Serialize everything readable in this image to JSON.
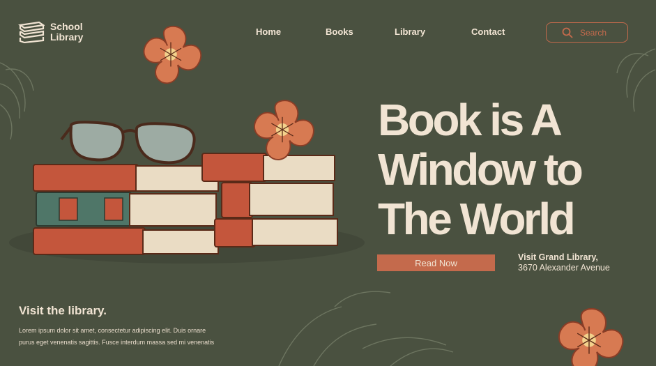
{
  "brand": {
    "line1": "School",
    "line2": "Library"
  },
  "nav": [
    {
      "label": "Home"
    },
    {
      "label": "Books"
    },
    {
      "label": "Library"
    },
    {
      "label": "Contact"
    }
  ],
  "search": {
    "label": "Search"
  },
  "hero": {
    "line1": "Book is A",
    "line2": "Window to",
    "line3": "The World",
    "cta": "Read Now",
    "visit_name": "Visit Grand Library,",
    "visit_address": "3670 Alexander Avenue"
  },
  "footer": {
    "title": "Visit the library.",
    "body_line1": "Lorem ipsum dolor sit amet, consectetur adipiscing elit. Duis ornare",
    "body_line2": "purus eget venenatis sagittis. Fusce interdum massa sed mi venenatis"
  },
  "colors": {
    "background": "#4a5140",
    "accent": "#c46a4c",
    "cream": "#f1e4d3"
  }
}
